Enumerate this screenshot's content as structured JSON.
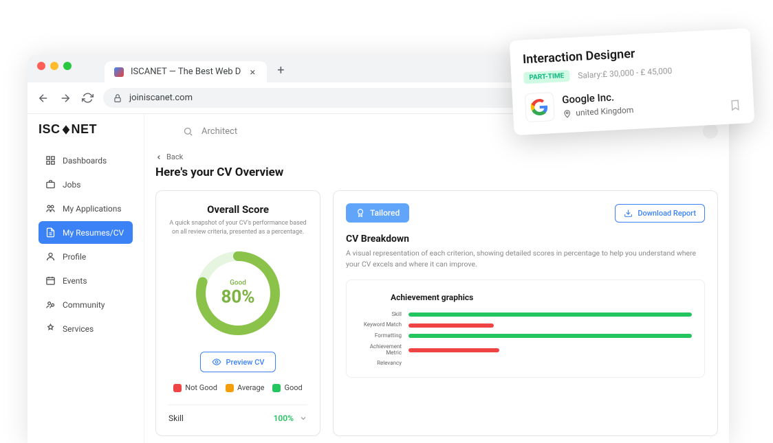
{
  "browser": {
    "tab_title": "ISCANET — The Best Web D",
    "url": "joiniscanet.com"
  },
  "logo": "ISCANET",
  "sidebar": {
    "items": [
      {
        "label": "Dashboards"
      },
      {
        "label": "Jobs"
      },
      {
        "label": "My Applications"
      },
      {
        "label": "My Resumes/CV"
      },
      {
        "label": "Profile"
      },
      {
        "label": "Events"
      },
      {
        "label": "Community"
      },
      {
        "label": "Services"
      }
    ]
  },
  "search": {
    "value": "Architect"
  },
  "back_label": "Back",
  "page_title": "Here's your CV Overview",
  "score": {
    "title": "Overall Score",
    "subtitle": "A quick snapshot of your CV's performance based on all review criteria, presented as a percentage.",
    "label": "Good",
    "value": "80%",
    "preview_label": "Preview CV"
  },
  "legend": {
    "not_good": "Not Good",
    "average": "Average",
    "good": "Good"
  },
  "metric": {
    "name": "Skill",
    "value": "100%"
  },
  "breakdown": {
    "tailored_label": "Tailored",
    "download_label": "Download  Report",
    "title": "CV Breakdown",
    "subtitle": "A visual representation of each criterion, showing detailed scores in percentage to help you understand where your CV excels and where it can improve.",
    "chart_title": "Achievement graphics"
  },
  "chart_data": {
    "type": "bar",
    "orientation": "horizontal",
    "title": "Achievement graphics",
    "categories": [
      "Skill",
      "Keyword Match",
      "Formatting",
      "Achievement Metric",
      "Relevancy"
    ],
    "series": [
      {
        "name": "Score",
        "values": [
          100,
          30,
          100,
          32,
          0
        ],
        "colors": [
          "#22c55e",
          "#ef4444",
          "#22c55e",
          "#ef4444",
          "#22c55e"
        ]
      }
    ],
    "xlim": [
      0,
      100
    ]
  },
  "job_card": {
    "title": "Interaction Designer",
    "badge": "PART-TIME",
    "salary_label": "Salary:",
    "salary_low": "£ 30,000",
    "salary_sep": " - ",
    "salary_high": "£ 45,000",
    "company": "Google Inc.",
    "location": "united Kingdom"
  }
}
